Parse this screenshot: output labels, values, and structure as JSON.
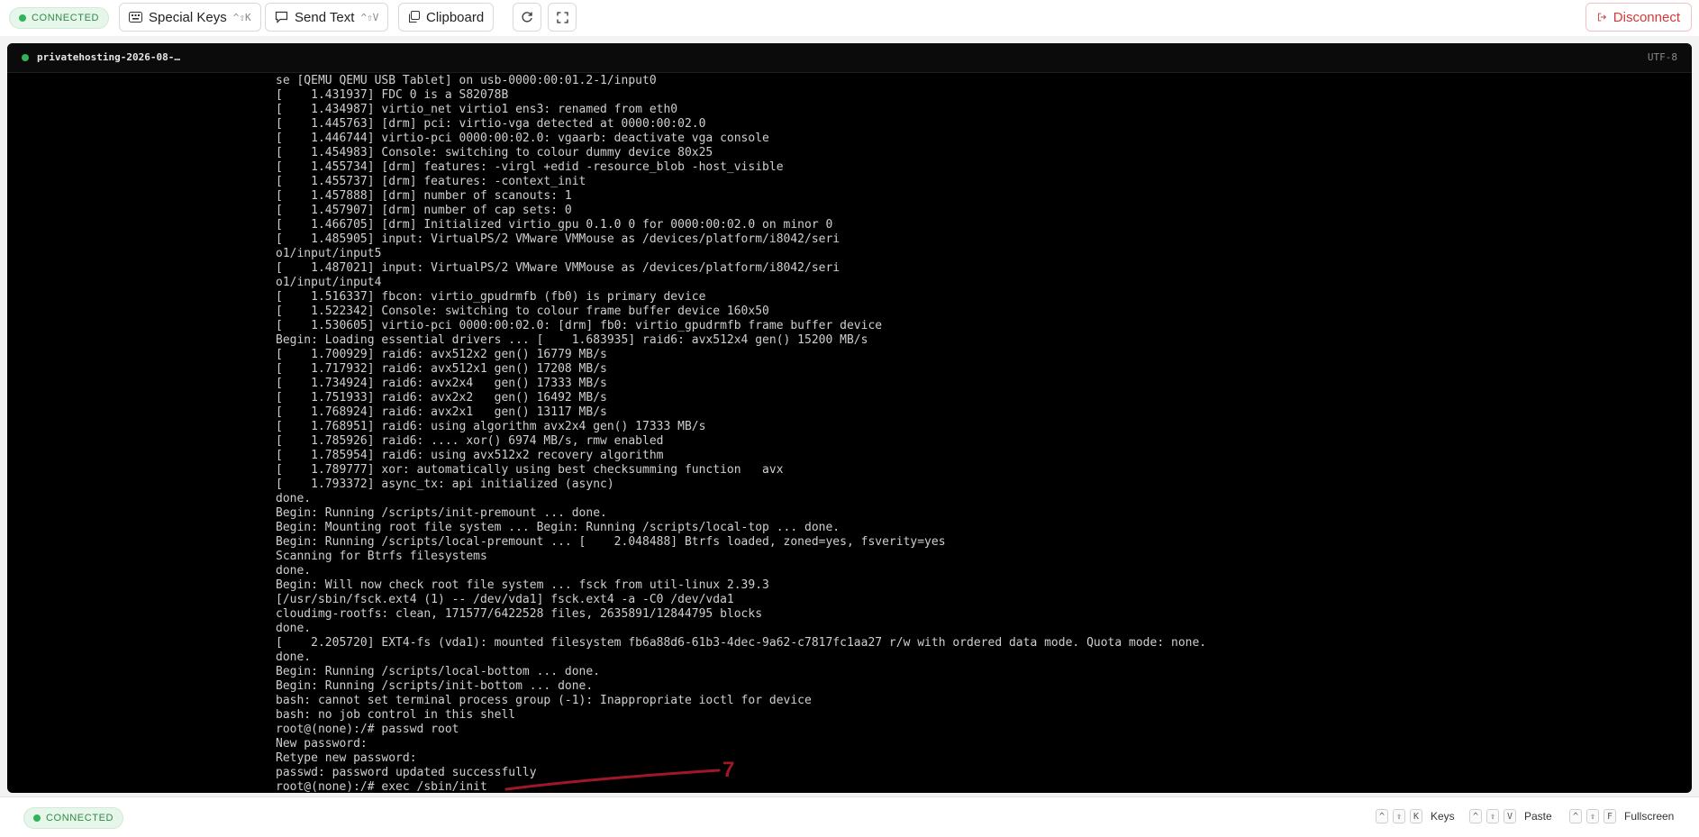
{
  "toolbar": {
    "status": "CONNECTED",
    "special_keys_label": "Special Keys",
    "special_keys_shortcut": "^⇧K",
    "send_text_label": "Send Text",
    "send_text_shortcut": "^⇧V",
    "clipboard_label": "Clipboard",
    "disconnect_label": "Disconnect",
    "disconnect_color": "#d33a3a",
    "icons": [
      "keyboard-icon",
      "message-icon",
      "clipboard-icon",
      "refresh-icon",
      "fullscreen-icon",
      "logout-icon"
    ]
  },
  "terminal": {
    "title": "privatehosting-2026-08-…",
    "encoding": "UTF-8",
    "lines": [
      "se [QEMU QEMU USB Tablet] on usb-0000:00:01.2-1/input0",
      "[    1.431937] FDC 0 is a S82078B",
      "[    1.434987] virtio_net virtio1 ens3: renamed from eth0",
      "[    1.445763] [drm] pci: virtio-vga detected at 0000:00:02.0",
      "[    1.446744] virtio-pci 0000:00:02.0: vgaarb: deactivate vga console",
      "[    1.454983] Console: switching to colour dummy device 80x25",
      "[    1.455734] [drm] features: -virgl +edid -resource_blob -host_visible",
      "[    1.455737] [drm] features: -context_init",
      "[    1.457888] [drm] number of scanouts: 1",
      "[    1.457907] [drm] number of cap sets: 0",
      "[    1.466705] [drm] Initialized virtio_gpu 0.1.0 0 for 0000:00:02.0 on minor 0",
      "[    1.485905] input: VirtualPS/2 VMware VMMouse as /devices/platform/i8042/seri",
      "o1/input/input5",
      "[    1.487021] input: VirtualPS/2 VMware VMMouse as /devices/platform/i8042/seri",
      "o1/input/input4",
      "[    1.516337] fbcon: virtio_gpudrmfb (fb0) is primary device",
      "[    1.522342] Console: switching to colour frame buffer device 160x50",
      "[    1.530605] virtio-pci 0000:00:02.0: [drm] fb0: virtio_gpudrmfb frame buffer device",
      "Begin: Loading essential drivers ... [    1.683935] raid6: avx512x4 gen() 15200 MB/s",
      "[    1.700929] raid6: avx512x2 gen() 16779 MB/s",
      "[    1.717932] raid6: avx512x1 gen() 17208 MB/s",
      "[    1.734924] raid6: avx2x4   gen() 17333 MB/s",
      "[    1.751933] raid6: avx2x2   gen() 16492 MB/s",
      "[    1.768924] raid6: avx2x1   gen() 13117 MB/s",
      "[    1.768951] raid6: using algorithm avx2x4 gen() 17333 MB/s",
      "[    1.785926] raid6: .... xor() 6974 MB/s, rmw enabled",
      "[    1.785954] raid6: using avx512x2 recovery algorithm",
      "[    1.789777] xor: automatically using best checksumming function   avx",
      "[    1.793372] async_tx: api initialized (async)",
      "done.",
      "Begin: Running /scripts/init-premount ... done.",
      "Begin: Mounting root file system ... Begin: Running /scripts/local-top ... done.",
      "Begin: Running /scripts/local-premount ... [    2.048488] Btrfs loaded, zoned=yes, fsverity=yes",
      "Scanning for Btrfs filesystems",
      "done.",
      "Begin: Will now check root file system ... fsck from util-linux 2.39.3",
      "[/usr/sbin/fsck.ext4 (1) -- /dev/vda1] fsck.ext4 -a -C0 /dev/vda1",
      "cloudimg-rootfs: clean, 171577/6422528 files, 2635891/12844795 blocks",
      "done.",
      "[    2.205720] EXT4-fs (vda1): mounted filesystem fb6a88d6-61b3-4dec-9a62-c7817fc1aa27 r/w with ordered data mode. Quota mode: none.",
      "done.",
      "Begin: Running /scripts/local-bottom ... done.",
      "Begin: Running /scripts/init-bottom ... done.",
      "bash: cannot set terminal process group (-1): Inappropriate ioctl for device",
      "bash: no job control in this shell",
      "root@(none):/# passwd root",
      "New password:",
      "Retype new password:",
      "passwd: password updated successfully",
      "root@(none):/# exec /sbin/init"
    ]
  },
  "annotation": {
    "label": "7",
    "color": "#a01828"
  },
  "statusbar": {
    "status": "CONNECTED",
    "shortcuts": [
      {
        "keys": [
          "^",
          "⇧",
          "K"
        ],
        "label": "Keys"
      },
      {
        "keys": [
          "^",
          "⇧",
          "V"
        ],
        "label": "Paste"
      },
      {
        "keys": [
          "^",
          "⇧",
          "F"
        ],
        "label": "Fullscreen"
      }
    ]
  }
}
